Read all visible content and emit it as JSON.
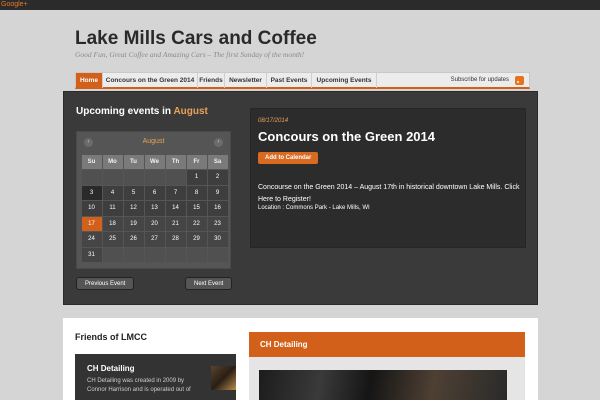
{
  "topbar": {
    "gplus_label": "Google+"
  },
  "site": {
    "title": "Lake Mills Cars and Coffee",
    "tagline": "Good Fun, Great Coffee and Amazing Cars – The first Sunday of the month!"
  },
  "nav": {
    "items": [
      "Home",
      "Concours on the Green 2014",
      "Friends",
      "Newsletter",
      "Past Events",
      "Upcoming Events"
    ],
    "active": "Home",
    "subscribe": "Subscribe for updates"
  },
  "upcoming": {
    "title_prefix": "Upcoming events in",
    "month": "August"
  },
  "calendar": {
    "month": "August",
    "prev_icon": "chevron-left-icon",
    "next_icon": "chevron-right-icon",
    "weekdays": [
      "Su",
      "Mo",
      "Tu",
      "We",
      "Th",
      "Fr",
      "Sa"
    ],
    "weeks": [
      [
        "",
        "",
        "",
        "",
        "",
        "1",
        "2"
      ],
      [
        "3",
        "4",
        "5",
        "6",
        "7",
        "8",
        "9"
      ],
      [
        "10",
        "11",
        "12",
        "13",
        "14",
        "15",
        "16"
      ],
      [
        "17",
        "18",
        "19",
        "20",
        "21",
        "22",
        "23"
      ],
      [
        "24",
        "25",
        "26",
        "27",
        "28",
        "29",
        "30"
      ],
      [
        "31",
        "",
        "",
        "",
        "",
        "",
        ""
      ]
    ],
    "today": "3",
    "event_day": "17"
  },
  "buttons": {
    "prev_event": "Previous Event",
    "next_event": "Next Event"
  },
  "event": {
    "date": "08/17/2014",
    "title": "Concours on the Green 2014",
    "add_to_calendar": "Add to Calendar",
    "description": "Concourse on the Green 2014 – August 17th in historical downtown Lake Mills. Click Here to Register!",
    "location": "Location : Commons Park - Lake Mills, WI"
  },
  "friends": {
    "title": "Friends of LMCC",
    "card_name": "CH Detailing",
    "card_text": "CH Detailing was created in 2009 by Connor Harrison and is operated out of"
  },
  "ch_panel": {
    "title": "CH Detailing"
  },
  "colors": {
    "accent": "#d2601a",
    "dark_panel": "#3a3a3a",
    "highlight": "#e8a25a"
  }
}
